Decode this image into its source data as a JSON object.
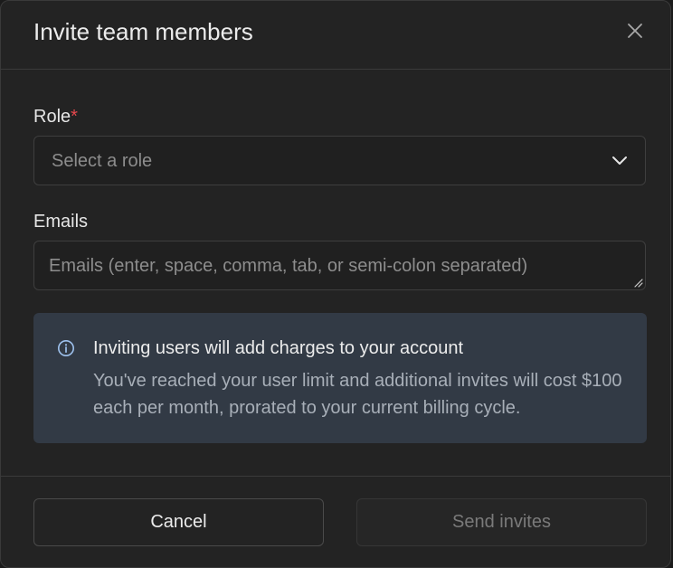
{
  "dialog": {
    "title": "Invite team members"
  },
  "role_field": {
    "label": "Role",
    "required_marker": "*",
    "placeholder": "Select a role"
  },
  "emails_field": {
    "label": "Emails",
    "placeholder": "Emails (enter, space, comma, tab, or semi-colon separated)"
  },
  "notice": {
    "title": "Inviting users will add charges to your account",
    "body": "You've reached your user limit and additional invites will cost $100 each per month, prorated to your current billing cycle.",
    "accent_color": "#9ec2ee"
  },
  "footer": {
    "cancel_label": "Cancel",
    "send_label": "Send invites"
  },
  "icons": {
    "close": "close-icon",
    "chevron": "chevron-down-icon",
    "info": "info-icon",
    "resize": "resize-grip-icon"
  }
}
